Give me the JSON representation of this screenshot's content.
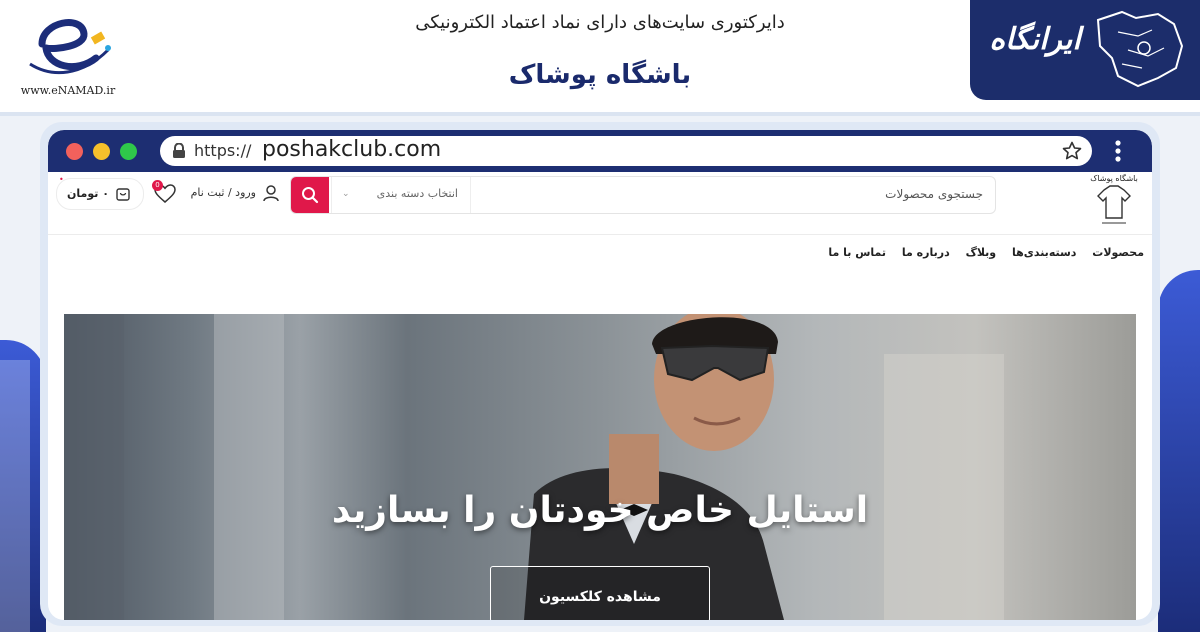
{
  "banner": {
    "enamad_url": "www.eNAMAD.ir",
    "directory_title": "دایرکتوری سایت‌های دارای نماد اعتماد الکترونیکی",
    "site_title": "باشگاه پوشاک",
    "irangah_logo": "ایرانگاه"
  },
  "browser": {
    "url_protocol": "https://",
    "url_host": "poshakclub.com"
  },
  "site": {
    "logo_text": "باشگاه پوشاک",
    "search_placeholder": "جستجوی محصولات",
    "category_select": "انتخاب دسته بندی",
    "login_label": "ورود / ثبت نام",
    "wishlist_count": "0",
    "cart_label": "۰ تومان",
    "nav": [
      "محصولات",
      "دسته‌بندی‌ها",
      "وبلاگ",
      "درباره ما",
      "تماس با ما"
    ]
  },
  "hero": {
    "title": "استایل خاص خودتان را بسازید",
    "button_label": "مشاهده کلکسیون"
  },
  "colors": {
    "brand_navy": "#1d2e72",
    "accent_red": "#e0184a"
  }
}
